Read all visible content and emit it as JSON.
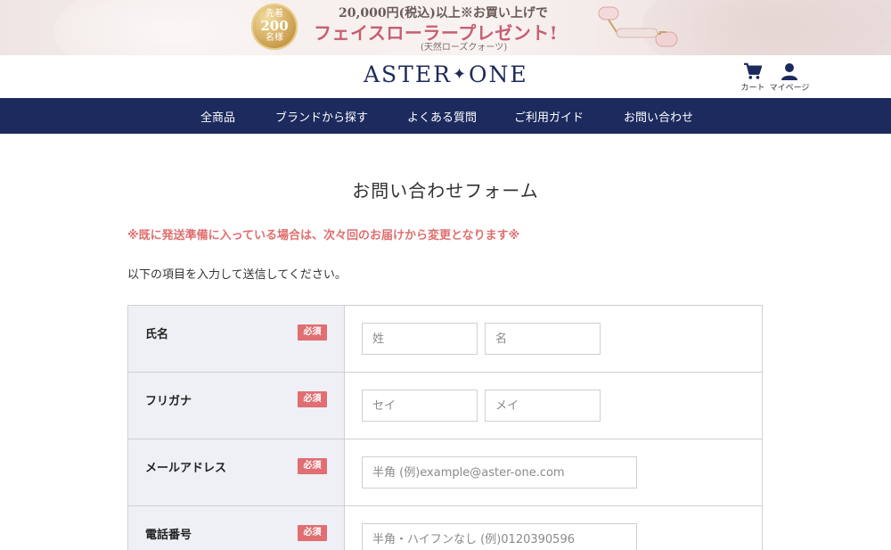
{
  "banner": {
    "badge_top": "先着",
    "badge_number": "200",
    "badge_bottom": "名様",
    "line1": "20,000円(税込)以上※お買い上げで",
    "line2": "フェイスローラープレゼント!",
    "line3": "(天然ローズクォーツ)"
  },
  "header": {
    "logo_left": "ASTER",
    "logo_right": "ONE",
    "logo_star": "✦",
    "cart_label": "カート",
    "mypage_label": "マイページ"
  },
  "nav": {
    "items": [
      "全商品",
      "ブランドから探す",
      "よくある質問",
      "ご利用ガイド",
      "お問い合わせ"
    ]
  },
  "main": {
    "title": "お問い合わせフォーム",
    "notice": "※既に発送準備に入っている場合は、次々回のお届けから変更となります※",
    "instruction": "以下の項目を入力して送信してください。"
  },
  "form": {
    "required_label": "必須",
    "rows": [
      {
        "label": "氏名",
        "placeholders": [
          "姓",
          "名"
        ]
      },
      {
        "label": "フリガナ",
        "placeholders": [
          "セイ",
          "メイ"
        ]
      },
      {
        "label": "メールアドレス",
        "placeholders": [
          "半角 (例)example@aster-one.com"
        ]
      },
      {
        "label": "電話番号",
        "placeholders": [
          "半角・ハイフンなし (例)0120390596"
        ]
      }
    ]
  },
  "colors": {
    "nav_bg": "#1c2a5e",
    "logo": "#1e2a5a",
    "notice": "#e06e6e",
    "required_badge": "#e06e72",
    "label_cell_bg": "#eef0f5",
    "promo_pink": "#c65f72"
  },
  "icons": {
    "cart": "cart-icon",
    "mypage": "user-icon",
    "roller": "face-roller-image"
  }
}
